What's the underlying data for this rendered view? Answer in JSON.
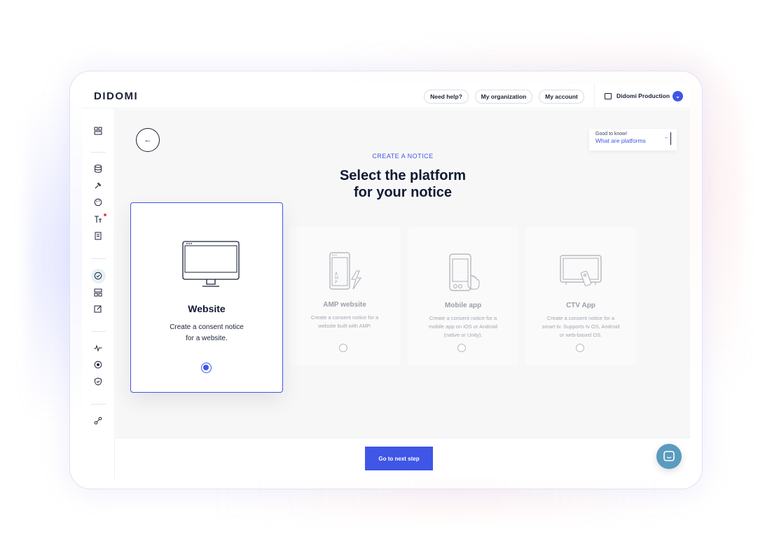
{
  "brand": {
    "logo": "DIDOMI",
    "accent": "#3f56e6"
  },
  "header": {
    "help_label": "Need help?",
    "org_label": "My organization",
    "account_label": "My account",
    "workspace_name": "Didomi Production"
  },
  "sidebar": {
    "items": [
      "dashboard-icon",
      "database-icon",
      "gavel-icon",
      "palette-icon",
      "text-icon",
      "document-icon",
      "check-circle-icon",
      "layout-icon",
      "edit-icon",
      "analytics-icon",
      "record-icon",
      "shield-icon",
      "integrations-icon"
    ],
    "text_item_has_notification": true
  },
  "tip": {
    "small": "Good to know!",
    "link": "What are platforms"
  },
  "page": {
    "eyebrow": "CREATE A NOTICE",
    "title_line1": "Select the platform",
    "title_line2": "for your notice"
  },
  "platforms": [
    {
      "name": "Website",
      "desc_line1": "Create a consent notice",
      "desc_line2": "for a website.",
      "selected": true,
      "icon": "monitor-icon"
    },
    {
      "name": "AMP website",
      "desc_line1": "Create a consent notice for a",
      "desc_line2": "website built with AMP.",
      "selected": false,
      "icon": "amp-phone-icon"
    },
    {
      "name": "Mobile app",
      "desc_line1": "Create a consent notice for a",
      "desc_line2": "mobile app on iOS or Android",
      "desc_line3": "(native or Unity).",
      "selected": false,
      "icon": "phone-hand-icon"
    },
    {
      "name": "CTV App",
      "desc_line1": "Create a consent notice for a",
      "desc_line2": "smart tv. Supports tv OS, Android",
      "desc_line3": "or web-based OS.",
      "selected": false,
      "icon": "tv-remote-icon"
    }
  ],
  "footer": {
    "next_label": "Go to next step"
  }
}
